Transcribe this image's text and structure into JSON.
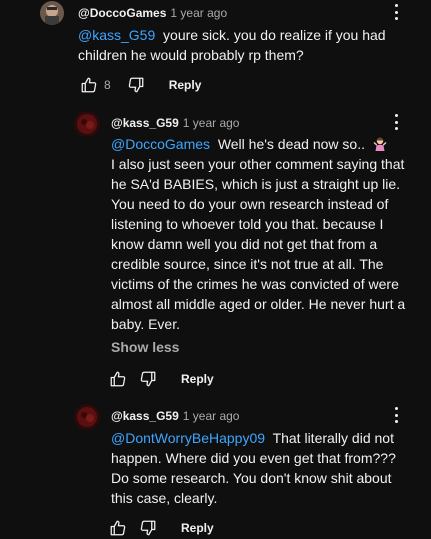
{
  "comments": [
    {
      "author": "@DoccoGames",
      "time": "1 year ago",
      "mention": "@kass_G59",
      "text": "youre sick. you do realize if you had children he would probably rp them?",
      "likes": "8",
      "reply_label": "Reply"
    },
    {
      "author": "@kass_G59",
      "time": "1 year ago",
      "mention": "@DoccoGames",
      "text": "Well he's dead now so..",
      "emoji": "person-shrugging",
      "paragraph": "I also just seen your other comment saying that he SA'd BABIES, which is just a straight up lie. You need to do your own research instead of listening to whoever told you that. because I know damn well you did not get that from a credible source, since it's not true at all. The victims of the crimes he was convicted of were almost all middle aged or older. He never hurt a baby. Ever.",
      "show_less_label": "Show less",
      "reply_label": "Reply"
    },
    {
      "author": "@kass_G59",
      "time": "1 year ago",
      "mention": "@DontWorryBeHappy09",
      "text": "That literally did not happen. Where did you even get that from??? Do some research. You don't know shit about this case, clearly.",
      "reply_label": "Reply"
    }
  ],
  "colors": {
    "background": "#0f0f0f",
    "text": "#f1f1f1",
    "secondary": "#aaaaaa",
    "mention": "#3ea6ff"
  }
}
